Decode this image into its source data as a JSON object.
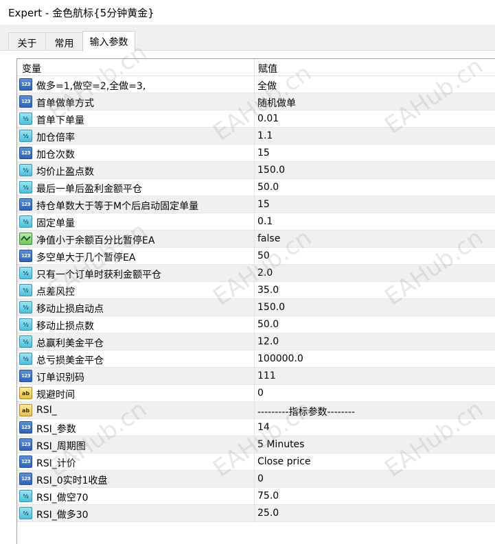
{
  "window": {
    "title": "Expert - 金色航标{5分钟黄金}"
  },
  "tabs": [
    {
      "label": "关于"
    },
    {
      "label": "常用"
    },
    {
      "label": "输入参数"
    }
  ],
  "grid": {
    "headers": {
      "variable": "变量",
      "value": "赋值"
    },
    "rows": [
      {
        "type": "int",
        "name": "做多=1,做空=2,全做=3,",
        "value": "全做"
      },
      {
        "type": "int",
        "name": "首单做单方式",
        "value": "随机做单"
      },
      {
        "type": "double",
        "name": "首单下单量",
        "value": "0.01"
      },
      {
        "type": "double",
        "name": "加仓倍率",
        "value": "1.1"
      },
      {
        "type": "int",
        "name": "加仓次数",
        "value": "15"
      },
      {
        "type": "double",
        "name": "均价止盈点数",
        "value": "150.0"
      },
      {
        "type": "double",
        "name": "最后一单后盈利金额平仓",
        "value": "50.0"
      },
      {
        "type": "int",
        "name": "持仓单数大于等于M个后启动固定单量",
        "value": "15"
      },
      {
        "type": "double",
        "name": "固定单量",
        "value": "0.1"
      },
      {
        "type": "bool",
        "name": "净值小于余额百分比暂停EA",
        "value": "false"
      },
      {
        "type": "int",
        "name": "多空单大于几个暂停EA",
        "value": "50"
      },
      {
        "type": "double",
        "name": "只有一个订单时获利金额平仓",
        "value": "2.0"
      },
      {
        "type": "double",
        "name": "点差风控",
        "value": "35.0"
      },
      {
        "type": "double",
        "name": "移动止损启动点",
        "value": "150.0"
      },
      {
        "type": "double",
        "name": "移动止损点数",
        "value": "50.0"
      },
      {
        "type": "double",
        "name": "总赢利美金平仓",
        "value": "12.0"
      },
      {
        "type": "double",
        "name": "总亏损美金平仓",
        "value": "100000.0"
      },
      {
        "type": "int",
        "name": "订单识别码",
        "value": "111"
      },
      {
        "type": "string",
        "name": "规避时间",
        "value": "0"
      },
      {
        "type": "string",
        "name": "RSI_",
        "value": "---------指标参数--------"
      },
      {
        "type": "int",
        "name": "RSI_参数",
        "value": "14"
      },
      {
        "type": "int",
        "name": "RSI_周期图",
        "value": "5 Minutes"
      },
      {
        "type": "int",
        "name": "RSI_计价",
        "value": "Close price"
      },
      {
        "type": "int",
        "name": "RSI_0实时1收盘",
        "value": "0"
      },
      {
        "type": "double",
        "name": "RSI_做空70",
        "value": "75.0"
      },
      {
        "type": "double",
        "name": "RSI_做多30",
        "value": "25.0"
      }
    ]
  },
  "icons": {
    "int": "int-param-icon (123)",
    "double": "double-param-icon (1/2)",
    "string": "string-param-icon (ab)",
    "bool": "bool-param-icon"
  },
  "icon_text": {
    "int": "123",
    "double": "½",
    "string": "ab"
  },
  "watermark": "EAHub.cn"
}
